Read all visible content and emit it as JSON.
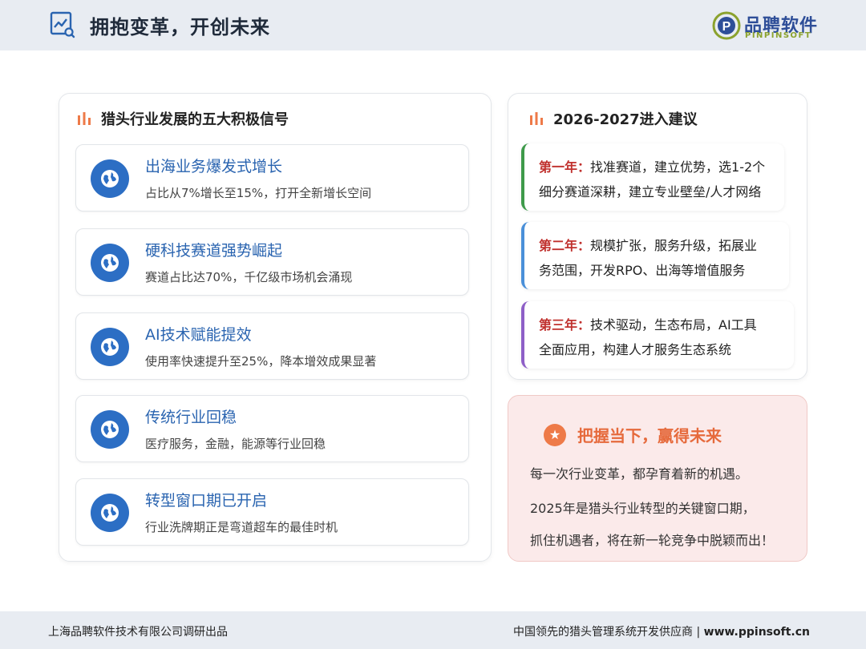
{
  "header": {
    "title": "拥抱变革，开创未来",
    "logo_cn": "品聘软件",
    "logo_en": "PINPINSOFT"
  },
  "signals": {
    "title": "猎头行业发展的五大积极信号",
    "items": [
      {
        "title": "出海业务爆发式增长",
        "desc": "占比从7%增长至15%，打开全新增长空间"
      },
      {
        "title": "硬科技赛道强势崛起",
        "desc": "赛道占比达70%，千亿级市场机会涌现"
      },
      {
        "title": "AI技术赋能提效",
        "desc": "使用率快速提升至25%，降本增效成果显著"
      },
      {
        "title": "传统行业回稳",
        "desc": "医疗服务，金融，能源等行业回稳"
      },
      {
        "title": "转型窗口期已开启",
        "desc": "行业洗牌期正是弯道超车的最佳时机"
      }
    ]
  },
  "plan": {
    "title": "2026-2027进入建议",
    "years": [
      {
        "label": "第一年：",
        "line1": "找准赛道，建立优势，选1-2个",
        "line2": "细分赛道深耕，建立专业壁垒/人才网络",
        "color": "#3e9a4a"
      },
      {
        "label": "第二年：",
        "line1": "规模扩张，服务升级，拓展业",
        "line2": "务范围，开发RPO、出海等增值服务",
        "color": "#4a90d9"
      },
      {
        "label": "第三年：",
        "line1": "技术驱动，生态布局，AI工具",
        "line2": "全面应用，构建人才服务生态系统",
        "color": "#8e5fc7"
      }
    ]
  },
  "seize": {
    "title": "把握当下，赢得未来",
    "lines": [
      "每一次行业变革，都孕育着新的机遇。",
      "2025年是猎头行业转型的关键窗口期，",
      "抓住机遇者，将在新一轮竞争中脱颖而出！"
    ]
  },
  "footer": {
    "left": "上海品聘软件技术有限公司调研出品",
    "right_text": "中国领先的猎头管理系统开发供应商 | ",
    "right_site": "www.ppinsoft.cn"
  }
}
